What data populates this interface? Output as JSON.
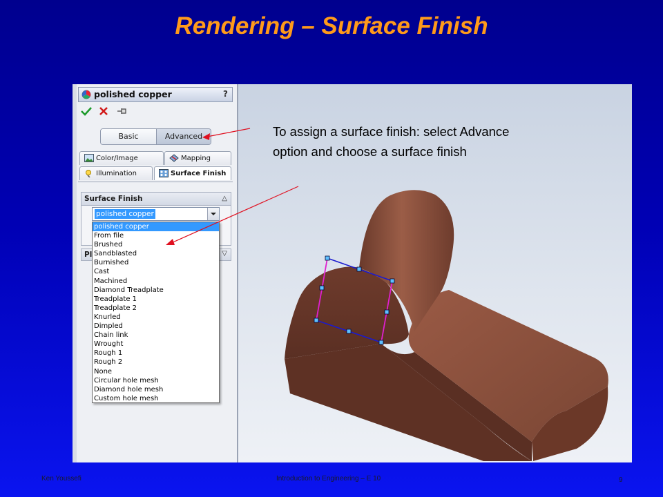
{
  "slide": {
    "title": "Rendering – Surface Finish",
    "footer_left": "Ken Youssefi",
    "footer_center": "Introduction to Engineering – E 10",
    "page_number": "9"
  },
  "property_manager": {
    "title": "polished copper",
    "help_label": "?",
    "actions": {
      "ok_icon": "check-icon",
      "cancel_icon": "close-icon",
      "pin_icon": "pushpin-icon"
    },
    "toggle": {
      "basic_label": "Basic",
      "advanced_label": "Advanced",
      "selected": "Advanced"
    },
    "tabs": [
      {
        "label": "Color/Image",
        "icon": "color-image-icon"
      },
      {
        "label": "Mapping",
        "icon": "mapping-icon"
      },
      {
        "label": "Illumination",
        "icon": "illumination-icon"
      },
      {
        "label": "Surface Finish",
        "icon": "surface-finish-icon",
        "active": true
      }
    ],
    "surface_finish_group": {
      "header": "Surface Finish",
      "selected_value": "polished copper",
      "options": [
        "polished copper",
        "From file",
        "Brushed",
        "Sandblasted",
        "Burnished",
        "Cast",
        "Machined",
        "Diamond Treadplate",
        "Treadplate 1",
        "Treadplate 2",
        "Knurled",
        "Dimpled",
        "Chain link",
        "Wrought",
        "Rough 1",
        "Rough 2",
        "None",
        "Circular hole mesh",
        "Diamond hole mesh",
        "Custom hole mesh"
      ]
    },
    "collapsed_group_header": "Pl"
  },
  "callout_text": "To assign a surface finish: select Advance option and choose a surface finish",
  "colors": {
    "title": "#ff9a1a",
    "copper": "#7a4634",
    "annotation_arrow": "#e01020",
    "selection_box_blue": "#1a1ad0",
    "selection_box_magenta": "#e020d0",
    "highlight": "#3399ff"
  }
}
